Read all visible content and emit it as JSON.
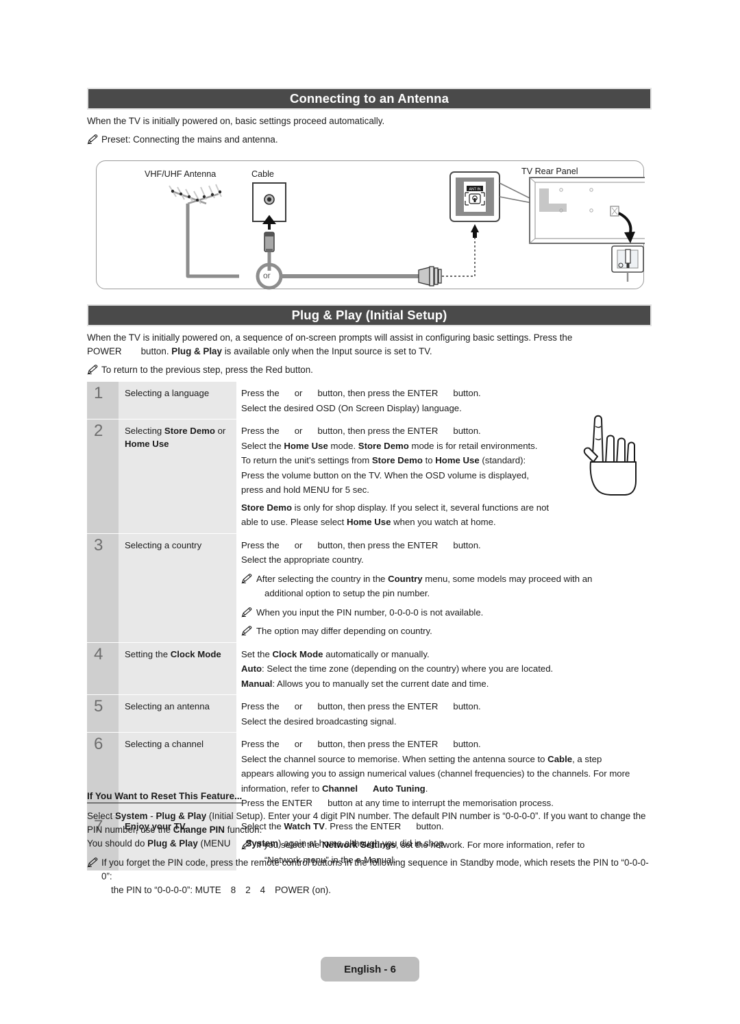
{
  "section1": {
    "title": "Connecting to an Antenna",
    "intro": "When the TV is initially powered on, basic settings proceed automatically.",
    "note": "Preset: Connecting the mains and antenna.",
    "diagram": {
      "label_antenna": "VHF/UHF Antenna",
      "label_cable": "Cable",
      "label_tv": "TV Rear Panel",
      "label_or": "or",
      "label_ant_in": "ANT IN"
    }
  },
  "section2": {
    "title": "Plug & Play (Initial Setup)",
    "intro_line1": "When the TV is initially powered on, a sequence of on-screen prompts will assist in configuring basic settings. Press the",
    "intro_power": "POWER",
    "intro_line2_a": "button.",
    "intro_line2_b": "Plug & Play",
    "intro_line2_c": "is available only when the Input source is set to TV.",
    "note": "To return to the previous step, press the Red button."
  },
  "steps": [
    {
      "num": "1",
      "label_a": "Selecting a language",
      "lines": [
        "Press the     or     button, then press the ENTER     button.",
        "Select the desired OSD (On Screen Display) language."
      ]
    },
    {
      "num": "2",
      "label_a": "Selecting ",
      "label_b": "Store Demo",
      "label_c": " or",
      "label_d": "Home Use",
      "lines": [
        "Press the     or     button, then press the ENTER     button.",
        "Select the Home Use mode. Store Demo mode is for retail environments.",
        "To return the unit's settings from Store Demo to Home Use (standard):",
        "Press the volume button on the TV. When the OSD volume is displayed,",
        "press and hold MENU for 5 sec.",
        "Store Demo is only for shop display. If you select it, several functions are not",
        "able to use. Please select Home Use when you watch at home."
      ]
    },
    {
      "num": "3",
      "label_a": "Selecting a country",
      "lines": [
        "Press the     or     button, then press the ENTER     button.",
        "Select the appropriate country."
      ],
      "notes": [
        "After selecting the country in the Country menu, some models may proceed with an additional option to setup the pin number.",
        "When you input the PIN number, 0-0-0-0 is not available.",
        "The option may differ depending on country."
      ]
    },
    {
      "num": "4",
      "label_a": "Setting the ",
      "label_b": "Clock Mode",
      "lines": [
        "Set the Clock Mode automatically or manually.",
        "Auto: Select the time zone (depending on the country) where you are located.",
        "Manual: Allows you to manually set the current date and time."
      ]
    },
    {
      "num": "5",
      "label_a": "Selecting an antenna",
      "lines": [
        "Press the     or     button, then press the ENTER     button.",
        "Select the desired broadcasting signal."
      ]
    },
    {
      "num": "6",
      "label_a": "Selecting a channel",
      "lines": [
        "Press the     or     button, then press the ENTER     button.",
        "Select the channel source to memorise. When setting the antenna source to Cable, a step appears allowing you to assign numerical values (channel frequencies) to the channels. For more information, refer to Channel     Auto Tuning.",
        "Press the ENTER     button at any time to interrupt the memorisation process."
      ]
    },
    {
      "num": "7",
      "label_a": "Enjoy your TV.",
      "lines": [
        "Select the Watch TV. Press the ENTER     button."
      ],
      "notes": [
        "If you select the Network Settings, set the network. For more information, refer to “Network menu” in the e-Manual."
      ]
    }
  ],
  "reset": {
    "heading": "If You Want to Reset This Feature...",
    "p1_a": "Select ",
    "p1_system": "System",
    "p1_b": " - ",
    "p1_pp": "Plug & Play",
    "p1_c": " (Initial Setup). Enter your 4 digit PIN number. The default PIN number is “0-0-0-0”. If you want to change the PIN number, use the ",
    "p1_changepin": "Change PIN",
    "p1_d": " function.",
    "p2_a": "You should do ",
    "p2_pp": "Plug & Play",
    "p2_b": " (MENU",
    "p2_system": "System",
    "p2_c": ") again at home although you did in shop.",
    "note_a": "If you forget the PIN code, press the remote control buttons in the following sequence in Standby mode, which resets the PIN to “0-0-0-0”: ",
    "note_mute": "MUTE",
    "note_8": "8",
    "note_2": "2",
    "note_4": "4",
    "note_power": "POWER",
    "note_on": "(on)."
  },
  "footer": {
    "page_label": "English - 6"
  },
  "colors": {
    "bar_bg": "#4a4a4a",
    "num_cell": "#cfcfcf",
    "label_cell": "#e8e8e8",
    "footer_bg": "#bdbdbd"
  }
}
